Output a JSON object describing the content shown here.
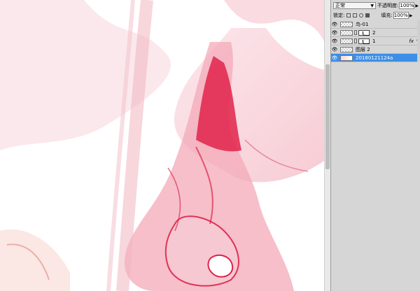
{
  "panel": {
    "blend_mode": "正常",
    "opacity_label": "不透明度:",
    "opacity_value": "100%",
    "lock_label": "锁定:",
    "fill_label": "填充:",
    "fill_value": "100%"
  },
  "layers": [
    {
      "name": "鸟-01",
      "visible": true,
      "selected": false
    },
    {
      "name": "2",
      "visible": true,
      "selected": false
    },
    {
      "name": "1",
      "visible": true,
      "selected": false,
      "fx": "fx"
    },
    {
      "name": "图层 2",
      "visible": true,
      "selected": false
    },
    {
      "name": "20180121124a",
      "visible": true,
      "selected": true
    }
  ],
  "colors": {
    "ink_primary": "#e0234a",
    "ink_light": "#f4b7c2",
    "panel_bg": "#d6d6d6",
    "selection": "#3d8ee6"
  }
}
